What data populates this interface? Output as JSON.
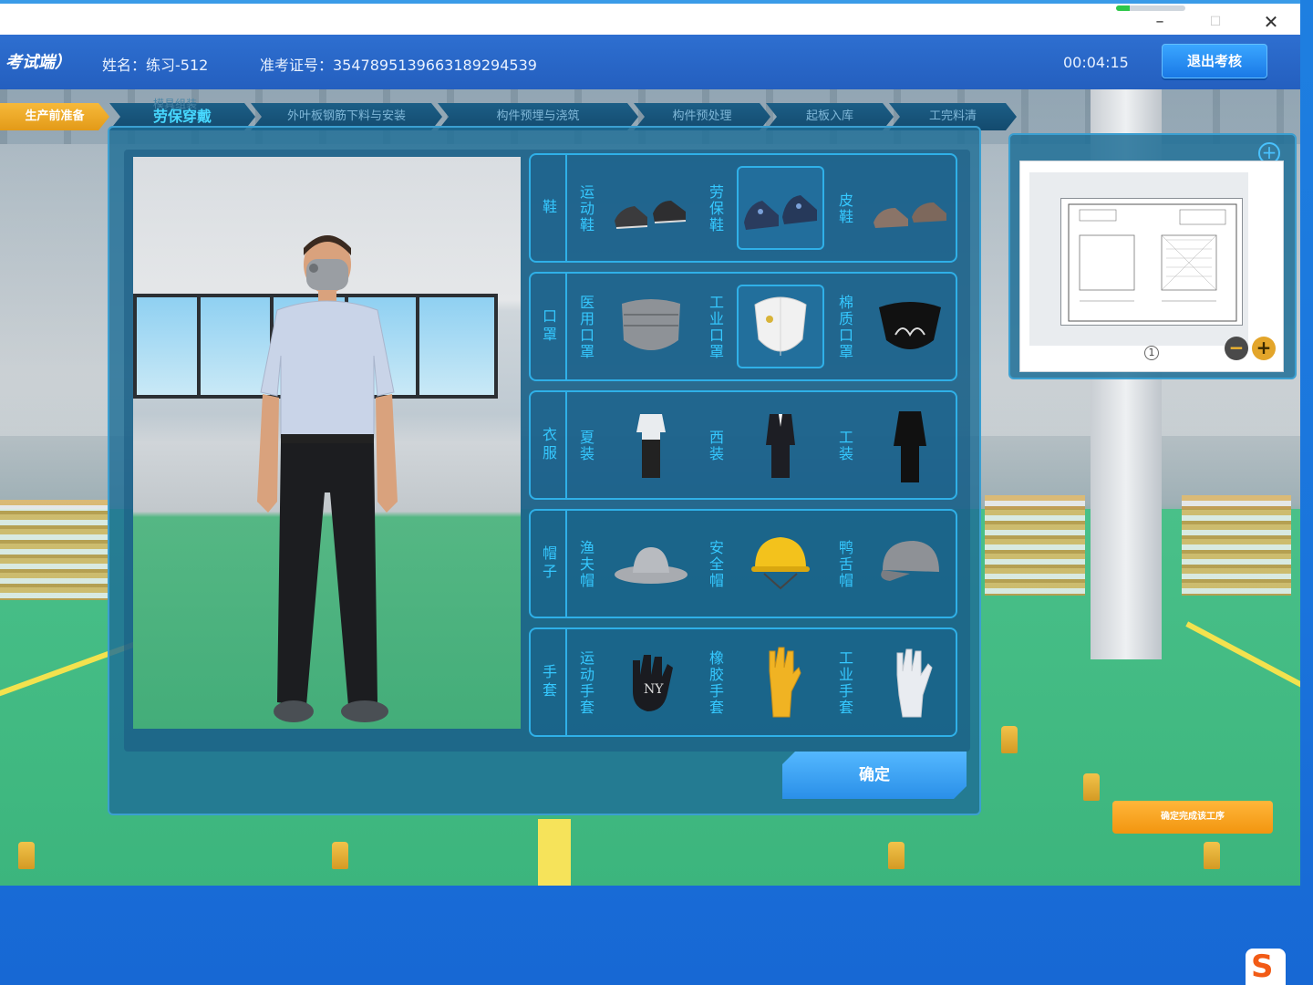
{
  "window": {
    "progress_fraction": 0.2,
    "min_label": "–",
    "max_label": "☐",
    "close_label": "✕"
  },
  "header": {
    "logo": "考试端）",
    "name": "姓名：练习-512",
    "exam_id": "准考证号：354789513966318929453​9",
    "timer": "00:04:15",
    "exit_label": "退出考核"
  },
  "steps": [
    {
      "label": "生产前准备"
    },
    {
      "label": "劳保穿戴"
    },
    {
      "label": "外叶板钢筋下料与安装"
    },
    {
      "label": "构件预埋与浇筑"
    },
    {
      "label": "构件预处理"
    },
    {
      "label": "起板入库"
    },
    {
      "label": "工完料清"
    }
  ],
  "step_header_behind": "模具组装",
  "categories": [
    {
      "label": "鞋",
      "options": [
        {
          "label": "运动鞋",
          "icon": "sneaker-icon"
        },
        {
          "label": "劳保鞋",
          "icon": "safety-shoe-icon",
          "selected": true
        },
        {
          "label": "皮鞋",
          "icon": "leather-shoe-icon"
        }
      ]
    },
    {
      "label": "口罩",
      "options": [
        {
          "label": "医用口罩",
          "icon": "medical-mask-icon"
        },
        {
          "label": "工业口罩",
          "icon": "industrial-mask-icon",
          "selected": true
        },
        {
          "label": "棉质口罩",
          "icon": "cotton-mask-icon"
        }
      ]
    },
    {
      "label": "衣服",
      "options": [
        {
          "label": "夏装",
          "icon": "summer-clothes-icon"
        },
        {
          "label": "西装",
          "icon": "suit-icon"
        },
        {
          "label": "工装",
          "icon": "workwear-icon"
        }
      ]
    },
    {
      "label": "帽子",
      "options": [
        {
          "label": "渔夫帽",
          "icon": "bucket-hat-icon"
        },
        {
          "label": "安全帽",
          "icon": "hard-hat-icon"
        },
        {
          "label": "鸭舌帽",
          "icon": "baseball-cap-icon"
        }
      ]
    },
    {
      "label": "手套",
      "options": [
        {
          "label": "运动手套",
          "icon": "sport-glove-icon"
        },
        {
          "label": "橡胶手套",
          "icon": "rubber-glove-icon"
        },
        {
          "label": "工业手套",
          "icon": "industrial-glove-icon"
        }
      ]
    }
  ],
  "confirm_label": "确定",
  "drawing": {
    "page_number": "1",
    "zoom_in": "+",
    "zoom_out": "−",
    "zoom_top": "+"
  },
  "complete_label": "确定完成该工序",
  "taskbar": {
    "ime": "S"
  },
  "colors": {
    "accent": "#2fb0e8",
    "label_cyan": "#35c8ff",
    "orange": "#f2950f"
  }
}
